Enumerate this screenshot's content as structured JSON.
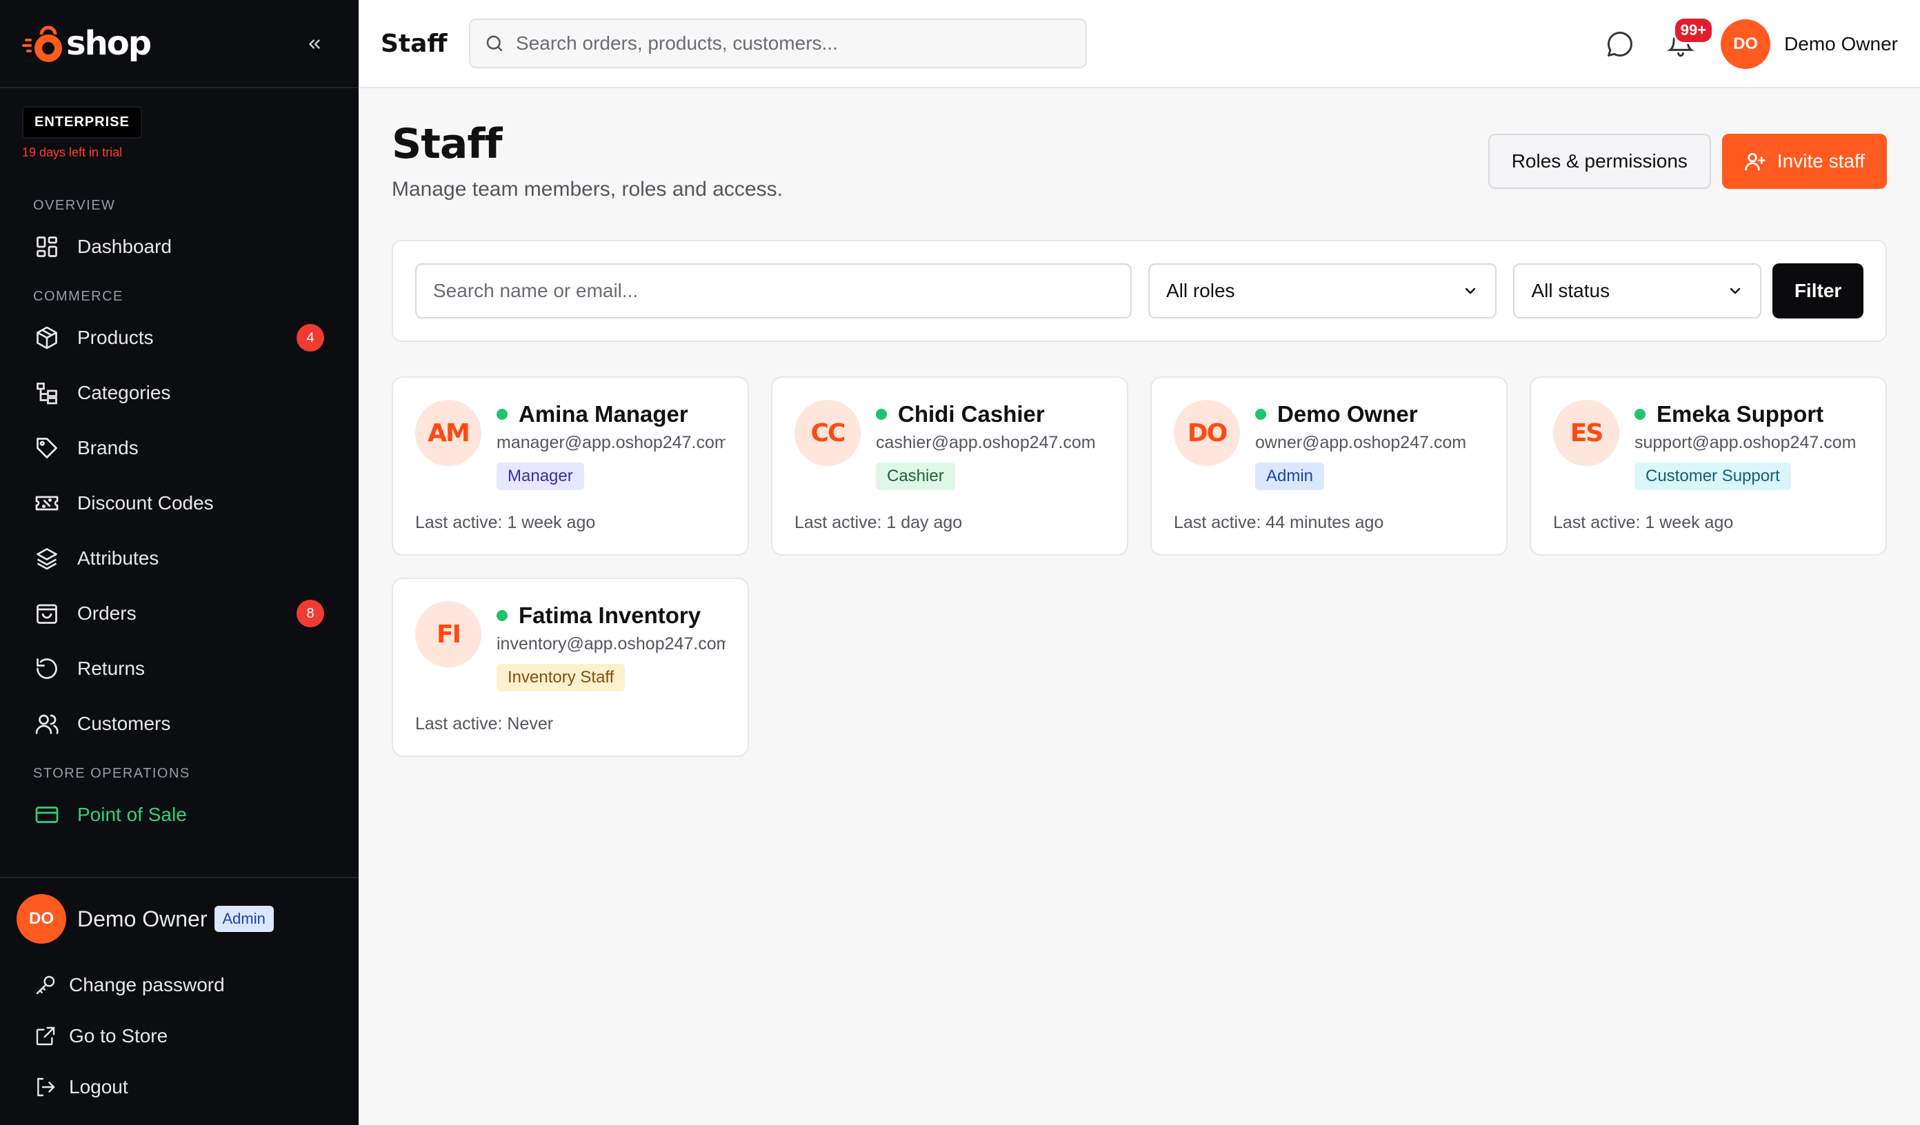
{
  "brand": {
    "name": "shop",
    "accent": "#ff5a1f"
  },
  "plan": {
    "badge": "ENTERPRISE",
    "trial": "19 days left in trial"
  },
  "sidebar": {
    "sections": [
      {
        "label": "OVERVIEW",
        "items": [
          {
            "label": "Dashboard",
            "icon": "dashboard-icon"
          }
        ]
      },
      {
        "label": "COMMERCE",
        "items": [
          {
            "label": "Products",
            "icon": "box-icon",
            "count": "4"
          },
          {
            "label": "Categories",
            "icon": "categories-icon"
          },
          {
            "label": "Brands",
            "icon": "tag-icon"
          },
          {
            "label": "Discount Codes",
            "icon": "ticket-icon"
          },
          {
            "label": "Attributes",
            "icon": "layers-icon"
          },
          {
            "label": "Orders",
            "icon": "bag-icon",
            "count": "8"
          },
          {
            "label": "Returns",
            "icon": "undo-icon"
          },
          {
            "label": "Customers",
            "icon": "users-icon"
          }
        ]
      },
      {
        "label": "STORE OPERATIONS",
        "items": [
          {
            "label": "Point of Sale",
            "icon": "pos-icon"
          }
        ]
      }
    ],
    "user": {
      "initials": "DO",
      "name": "Demo Owner",
      "role": "Admin"
    },
    "footer": {
      "change_password": "Change password",
      "go_to_store": "Go to Store",
      "logout": "Logout"
    }
  },
  "header": {
    "title": "Staff",
    "search_placeholder": "Search orders, products, customers...",
    "notifications": "99+",
    "user_initials": "DO",
    "user_name": "Demo Owner"
  },
  "page": {
    "title": "Staff",
    "subtitle": "Manage team members, roles and access.",
    "roles_button": "Roles & permissions",
    "invite_button": "Invite staff"
  },
  "filters": {
    "search_placeholder": "Search name or email...",
    "role": "All roles",
    "status": "All status",
    "filter_button": "Filter"
  },
  "staff": [
    {
      "initials": "AM",
      "name": "Amina Manager",
      "email": "manager@app.oshop247.com",
      "role": "Manager",
      "role_bg": "#e6e8ff",
      "role_fg": "#3730a3",
      "last_active": "Last active: 1 week ago"
    },
    {
      "initials": "CC",
      "name": "Chidi Cashier",
      "email": "cashier@app.oshop247.com",
      "role": "Cashier",
      "role_bg": "#dff7e6",
      "role_fg": "#166534",
      "last_active": "Last active: 1 day ago"
    },
    {
      "initials": "DO",
      "name": "Demo Owner",
      "email": "owner@app.oshop247.com",
      "role": "Admin",
      "role_bg": "#dbe7ff",
      "role_fg": "#1e40af",
      "last_active": "Last active: 44 minutes ago"
    },
    {
      "initials": "ES",
      "name": "Emeka Support",
      "email": "support@app.oshop247.com",
      "role": "Customer Support",
      "role_bg": "#d9f6fb",
      "role_fg": "#155e75",
      "last_active": "Last active: 1 week ago"
    },
    {
      "initials": "FI",
      "name": "Fatima Inventory",
      "email": "inventory@app.oshop247.com",
      "role": "Inventory Staff",
      "role_bg": "#fdf1cf",
      "role_fg": "#854d0e",
      "last_active": "Last active: Never"
    }
  ]
}
